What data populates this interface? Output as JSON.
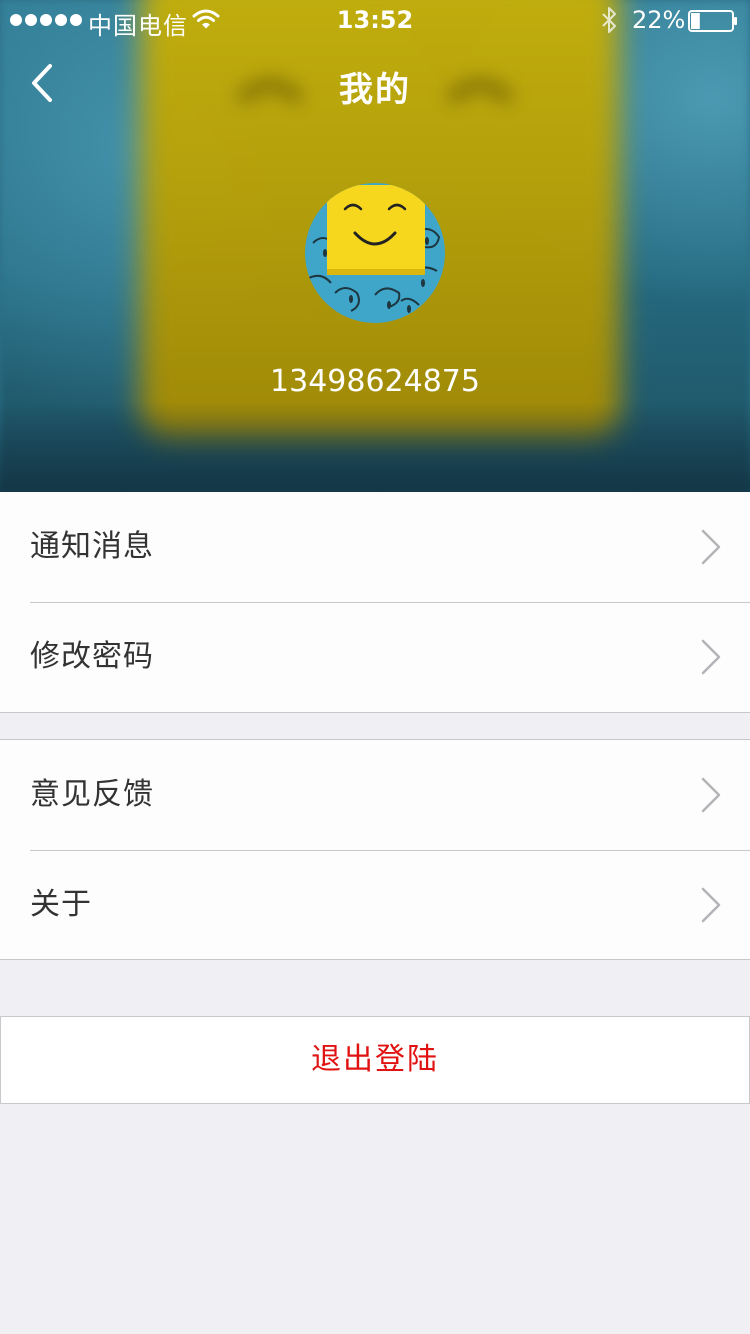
{
  "status_bar": {
    "carrier": "中国电信",
    "time": "13:52",
    "battery": "22%",
    "battery_level": 0.22,
    "icons": [
      "signal-dots-icon",
      "wifi-icon",
      "bluetooth-icon",
      "battery-icon"
    ]
  },
  "nav": {
    "title": "我的",
    "back_icon": "chevron-left-icon"
  },
  "profile": {
    "avatar": "smiley-sticky-note-avatar",
    "phone": "13498624875"
  },
  "menu_groups": [
    {
      "items": [
        {
          "label": "通知消息",
          "icon": "chevron-right-icon"
        },
        {
          "label": "修改密码",
          "icon": "chevron-right-icon"
        }
      ]
    },
    {
      "items": [
        {
          "label": "意见反馈",
          "icon": "chevron-right-icon"
        },
        {
          "label": "关于",
          "icon": "chevron-right-icon"
        }
      ]
    }
  ],
  "logout": {
    "label": "退出登陆"
  },
  "colors": {
    "background": "#efeff4",
    "row_background": "#fdfdfd",
    "logout_text": "#e01212",
    "label_text": "#333333",
    "divider": "#c8c7cc",
    "header_yellow": "#b8a006",
    "header_blue": "#2b6f86"
  }
}
